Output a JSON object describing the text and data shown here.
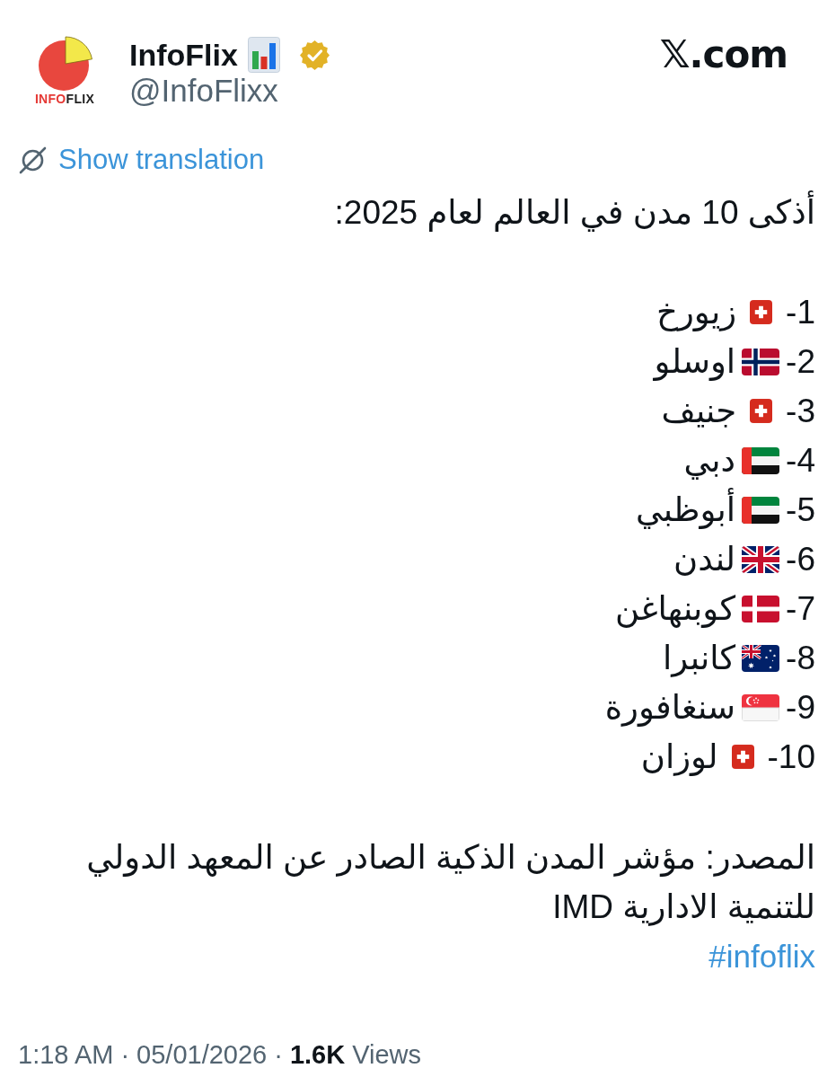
{
  "author": {
    "logo_text": {
      "lead": "INFO",
      "tail": "FLIX"
    },
    "name": "InfoFlix",
    "verified": true,
    "handle": "@InfoFlixx"
  },
  "site": {
    "label": "𝕏.com"
  },
  "translate_link": {
    "label": "Show translation"
  },
  "post": {
    "heading": "أذكى 10 مدن في العالم لعام 2025:",
    "cities": [
      {
        "rank": "1-",
        "kind": "switzerland",
        "city": "زيورخ"
      },
      {
        "rank": "2-",
        "kind": "norway",
        "city": "اوسلو"
      },
      {
        "rank": "3-",
        "kind": "switzerland",
        "city": "جنيف"
      },
      {
        "rank": "4-",
        "kind": "uae",
        "city": "دبي"
      },
      {
        "rank": "5-",
        "kind": "uae",
        "city": "أبوظبي"
      },
      {
        "rank": "6-",
        "kind": "uk",
        "city": "لندن"
      },
      {
        "rank": "7-",
        "kind": "denmark",
        "city": "كوبنهاغن"
      },
      {
        "rank": "8-",
        "kind": "australia",
        "city": "كانبرا"
      },
      {
        "rank": "9-",
        "kind": "singapore",
        "city": "سنغافورة"
      },
      {
        "rank": "10-",
        "kind": "switzerland",
        "city": "لوزان"
      }
    ],
    "source": "المصدر: مؤشر المدن الذكية الصادر عن المعهد الدولي للتنمية الادارية IMD",
    "hashtag": "#infoflix"
  },
  "footer": {
    "time": "1:18 AM",
    "separator_1": "·",
    "date": "05/01/2026",
    "separator_2": "·",
    "views_count": "1.6K",
    "views_label": "Views"
  }
}
